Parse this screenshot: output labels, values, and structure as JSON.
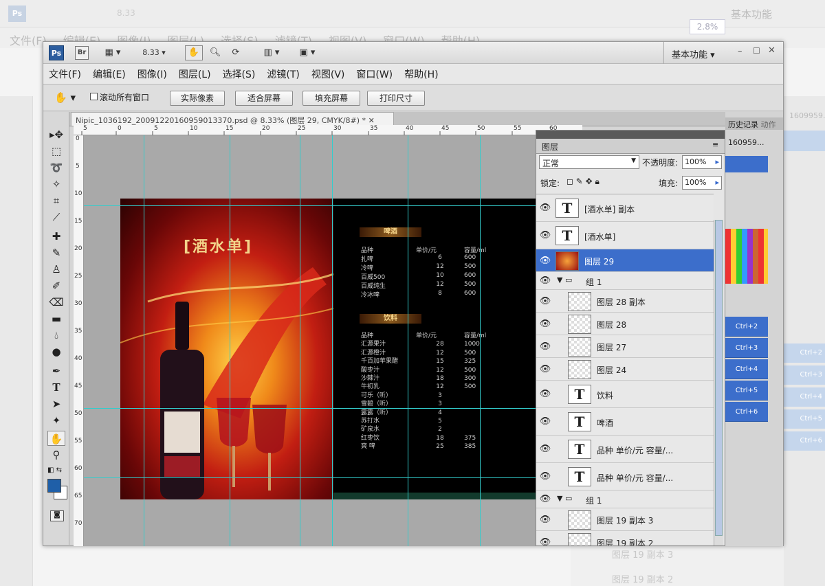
{
  "background": {
    "workspace_label": "基本功能",
    "zoom": "8.33",
    "menus": [
      "文件(F)",
      "编辑(E)",
      "图像(I)",
      "图层(L)",
      "选择(S)",
      "滤镜(T)",
      "视图(V)",
      "窗口(W)",
      "帮助(H)"
    ],
    "layer_labels": [
      "图层 19 副本 3",
      "图层 19 副本 2"
    ],
    "right_text": "1609959...",
    "right_shortcuts": [
      "Ctrl+2",
      "Ctrl+3",
      "Ctrl+4",
      "Ctrl+5",
      "Ctrl+6"
    ]
  },
  "zoom_popup": "2.8%",
  "window": {
    "ps_icon": "Ps",
    "br_icon": "Br",
    "zoom_value": "8.33",
    "workspace": "基本功能",
    "menus": [
      "文件(F)",
      "编辑(E)",
      "图像(I)",
      "图层(L)",
      "选择(S)",
      "滤镜(T)",
      "视图(V)",
      "窗口(W)",
      "帮助(H)"
    ],
    "options": {
      "scroll_all": "滚动所有窗口",
      "actual_pixels": "实际像素",
      "fit_screen": "适合屏幕",
      "fill_screen": "填充屏幕",
      "print_size": "打印尺寸"
    },
    "doc_tab": "Nipic_1036192_20091220160959013370.psd @ 8.33% (图层 29, CMYK/8#) *",
    "ruler_h": [
      "5",
      "0",
      "5",
      "10",
      "15",
      "20",
      "25",
      "30",
      "35",
      "40",
      "45",
      "50",
      "55",
      "60"
    ],
    "ruler_v": [
      "0",
      "5",
      "10",
      "15",
      "20",
      "25",
      "30",
      "35",
      "40",
      "45",
      "50",
      "55",
      "60",
      "65",
      "70"
    ]
  },
  "menu_card": {
    "title": "[酒水单]",
    "beer_header": "啤酒",
    "drinks_header": "饮料",
    "col_headers": [
      "品种",
      "单价/元",
      "容量/ml"
    ],
    "beer_rows": [
      [
        "扎啤",
        "6",
        "600"
      ],
      [
        "冷啤",
        "12",
        "500"
      ],
      [
        "百威500",
        "10",
        "600"
      ],
      [
        "百威纯生",
        "12",
        "500"
      ],
      [
        "冷冰啤",
        "8",
        "600"
      ]
    ],
    "drink_rows": [
      [
        "汇源果汁",
        "28",
        "1000"
      ],
      [
        "汇源橙汁",
        "12",
        "500"
      ],
      [
        "千百加苹果醋",
        "15",
        "325"
      ],
      [
        "酸枣汁",
        "12",
        "500"
      ],
      [
        "沙棘汁",
        "18",
        "300"
      ],
      [
        "牛初乳",
        "12",
        "500"
      ],
      [
        "可乐（听）",
        "3",
        ""
      ],
      [
        "雪碧（听）",
        "3",
        ""
      ],
      [
        "露露（听）",
        "4",
        ""
      ],
      [
        "苏打水",
        "5",
        ""
      ],
      [
        "矿泉水",
        "2",
        ""
      ],
      [
        "红枣饮",
        "18",
        "375"
      ],
      [
        "爽 啤",
        "25",
        "385"
      ]
    ]
  },
  "layers_panel": {
    "tab_label": "图层",
    "blend_mode": "正常",
    "opacity_label": "不透明度:",
    "opacity": "100%",
    "lock_label": "锁定:",
    "fill_label": "填充:",
    "fill": "100%",
    "rows": [
      {
        "type": "text",
        "name": "[酒水单] 副本"
      },
      {
        "type": "text",
        "name": "[酒水单]"
      },
      {
        "type": "image",
        "name": "图层 29",
        "selected": true
      },
      {
        "type": "group",
        "name": "组 1"
      },
      {
        "type": "raster",
        "name": "图层 28 副本"
      },
      {
        "type": "raster",
        "name": "图层 28"
      },
      {
        "type": "raster",
        "name": "图层 27"
      },
      {
        "type": "raster",
        "name": "图层 24"
      },
      {
        "type": "text",
        "name": "饮料"
      },
      {
        "type": "text",
        "name": "啤酒"
      },
      {
        "type": "text",
        "name": "品种         单价/元    容量/..."
      },
      {
        "type": "text",
        "name": "品种         单价/元    容量/..."
      },
      {
        "type": "group",
        "name": "组 1"
      },
      {
        "type": "raster",
        "name": "图层 19 副本 3"
      },
      {
        "type": "raster",
        "name": "图层 19 副本 2"
      }
    ]
  },
  "side_panel": {
    "history_tab": "历史记录",
    "actions_tab": "动作",
    "history_item": "160959...",
    "shortcuts": [
      "Ctrl+2",
      "Ctrl+3",
      "Ctrl+4",
      "Ctrl+5",
      "Ctrl+6"
    ]
  },
  "colors": {
    "accent": "#3c6ecb",
    "guide": "#33cccc",
    "ps_blue": "#2c5d9e"
  }
}
